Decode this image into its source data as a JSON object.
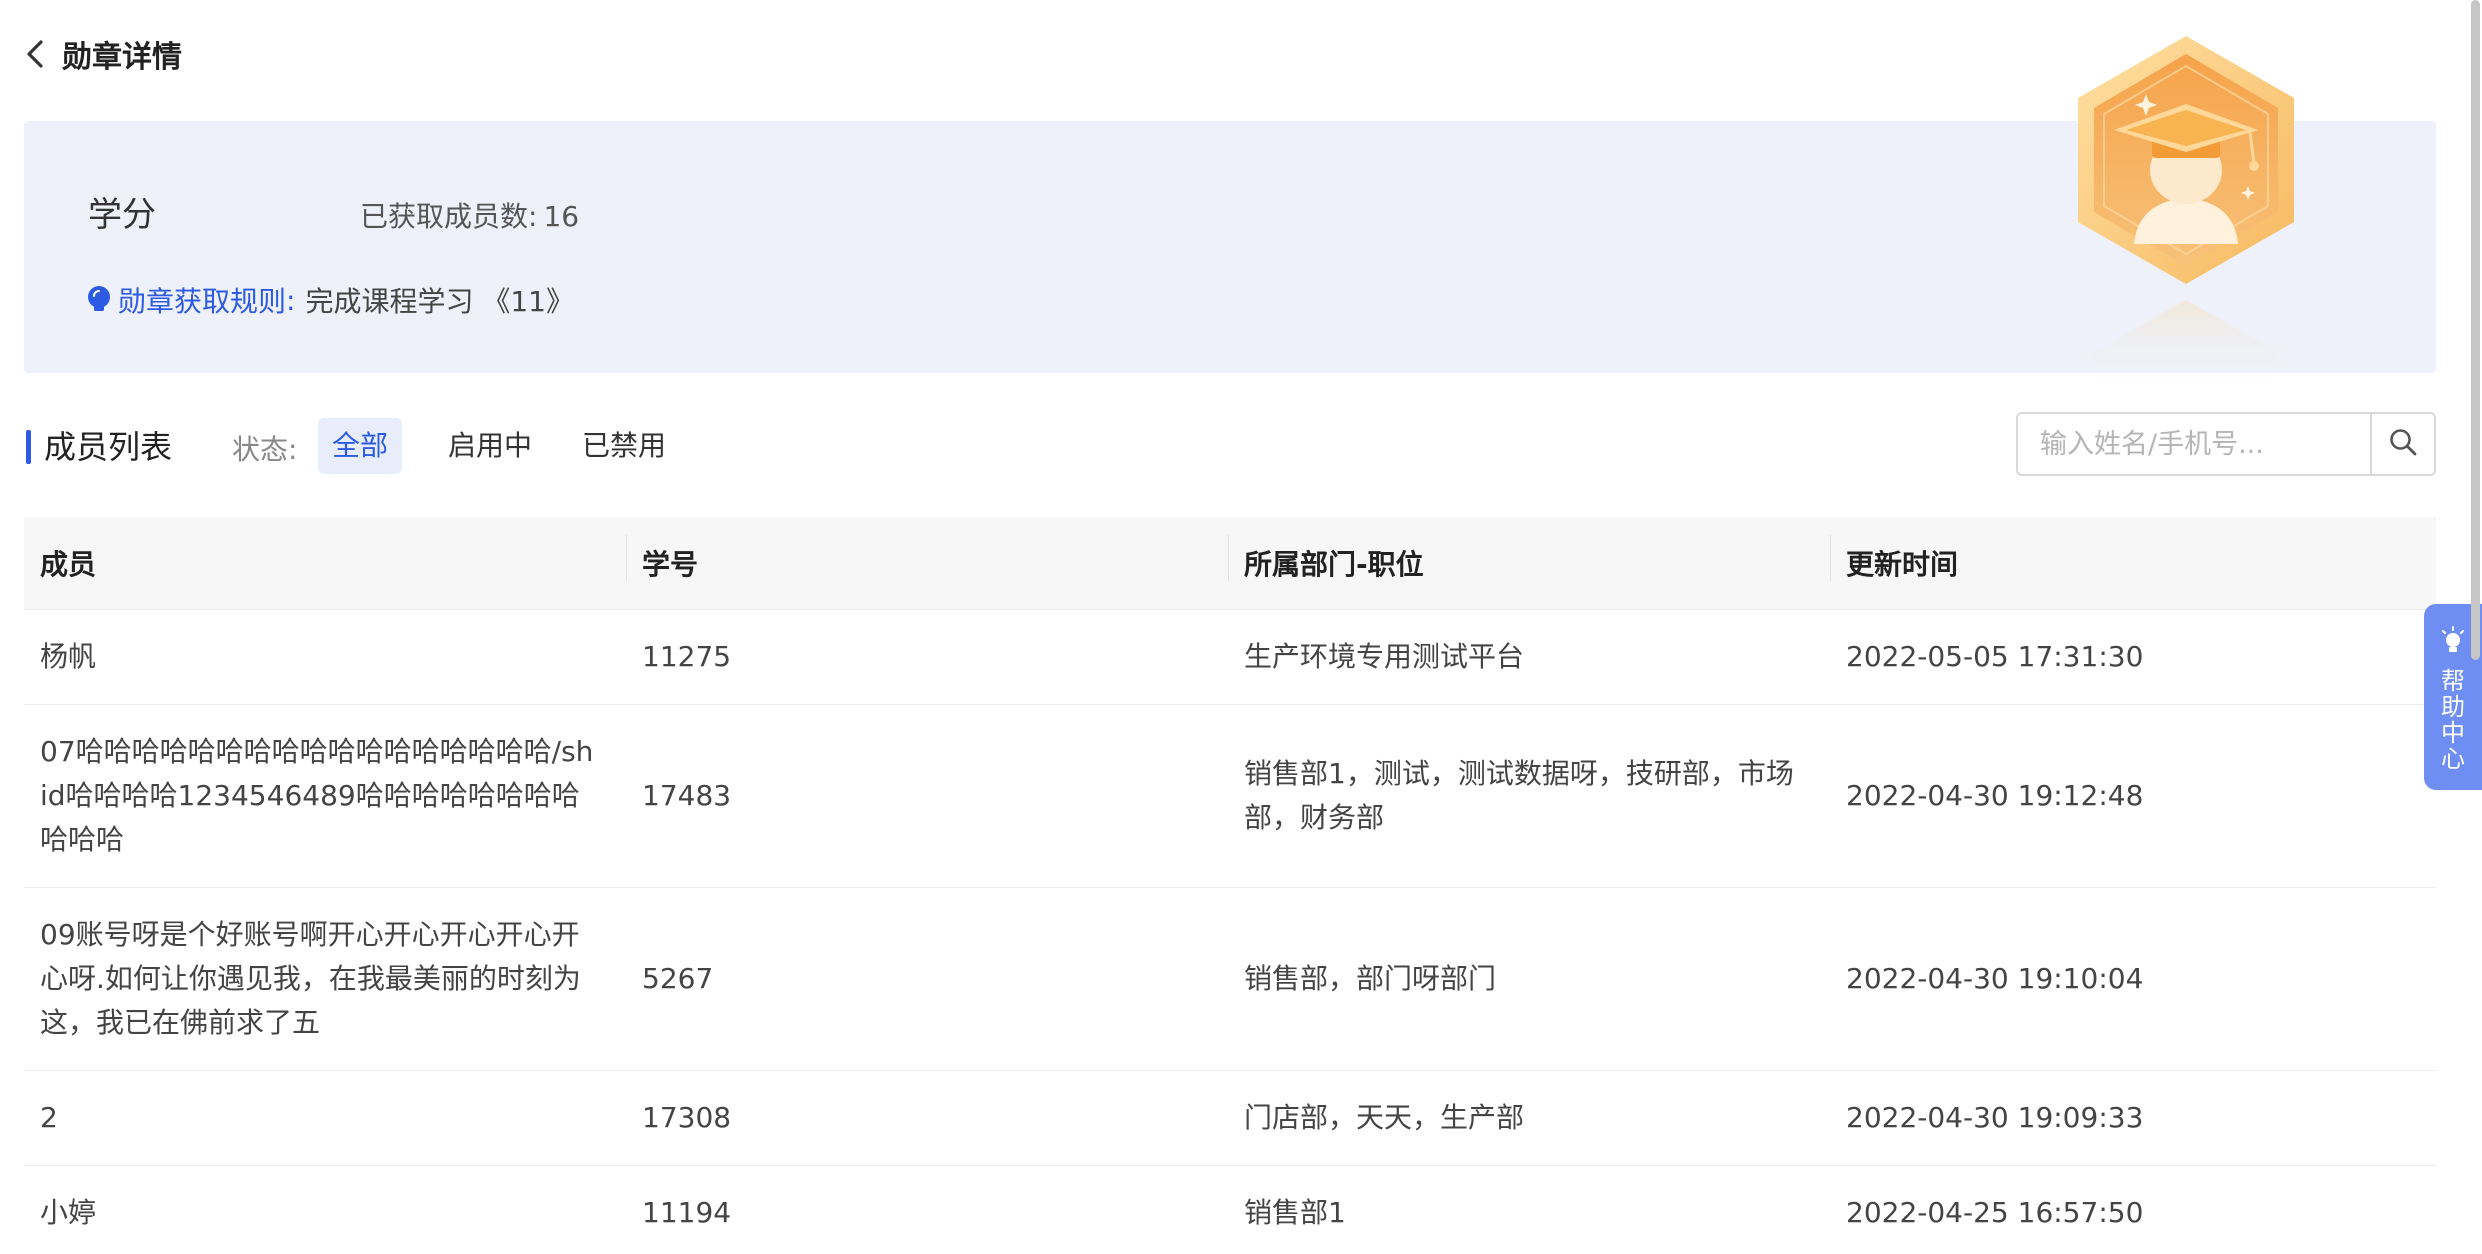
{
  "header": {
    "title": "勋章详情"
  },
  "badge": {
    "name": "学分",
    "earned_label": "已获取成员数:",
    "earned_count": "16",
    "rule_label": "勋章获取规则",
    "rule_colon": ":",
    "rule_value": "完成课程学习 《11》"
  },
  "list": {
    "title": "成员列表",
    "status_label": "状态:",
    "filters": [
      {
        "label": "全部",
        "active": true
      },
      {
        "label": "启用中",
        "active": false
      },
      {
        "label": "已禁用",
        "active": false
      }
    ],
    "search_placeholder": "输入姓名/手机号..."
  },
  "table": {
    "headers": [
      "成员",
      "学号",
      "所属部门-职位",
      "更新时间"
    ],
    "rows": [
      {
        "member": "杨帆",
        "id": "11275",
        "dept": "生产环境专用测试平台",
        "time": "2022-05-05 17:31:30"
      },
      {
        "member": "07哈哈哈哈哈哈哈哈哈哈哈哈哈哈哈哈哈/shid哈哈哈哈1234546489哈哈哈哈哈哈哈哈哈哈哈",
        "id": "17483",
        "dept": "销售部1，测试，测试数据呀，技研部，市场部，财务部",
        "time": "2022-04-30 19:12:48"
      },
      {
        "member": "09账号呀是个好账号啊开心开心开心开心开心呀.如何让你遇见我，在我最美丽的时刻为这，我已在佛前求了五",
        "id": "5267",
        "dept": "销售部，部门呀部门",
        "time": "2022-04-30 19:10:04"
      },
      {
        "member": "2",
        "id": "17308",
        "dept": "门店部，天天，生产部",
        "time": "2022-04-30 19:09:33"
      },
      {
        "member": "小婷",
        "id": "11194",
        "dept": "销售部1",
        "time": "2022-04-25 16:57:50"
      }
    ]
  },
  "help": {
    "label": "帮助中心"
  },
  "colors": {
    "accent": "#2c5ae3",
    "summary_bg": "#eef1f9",
    "help_bg": "#6e8ef3",
    "medal": "#f2a444"
  },
  "icons": [
    "back-arrow-icon",
    "lightbulb-icon",
    "medal-icon",
    "search-icon",
    "help-bulb-icon"
  ]
}
